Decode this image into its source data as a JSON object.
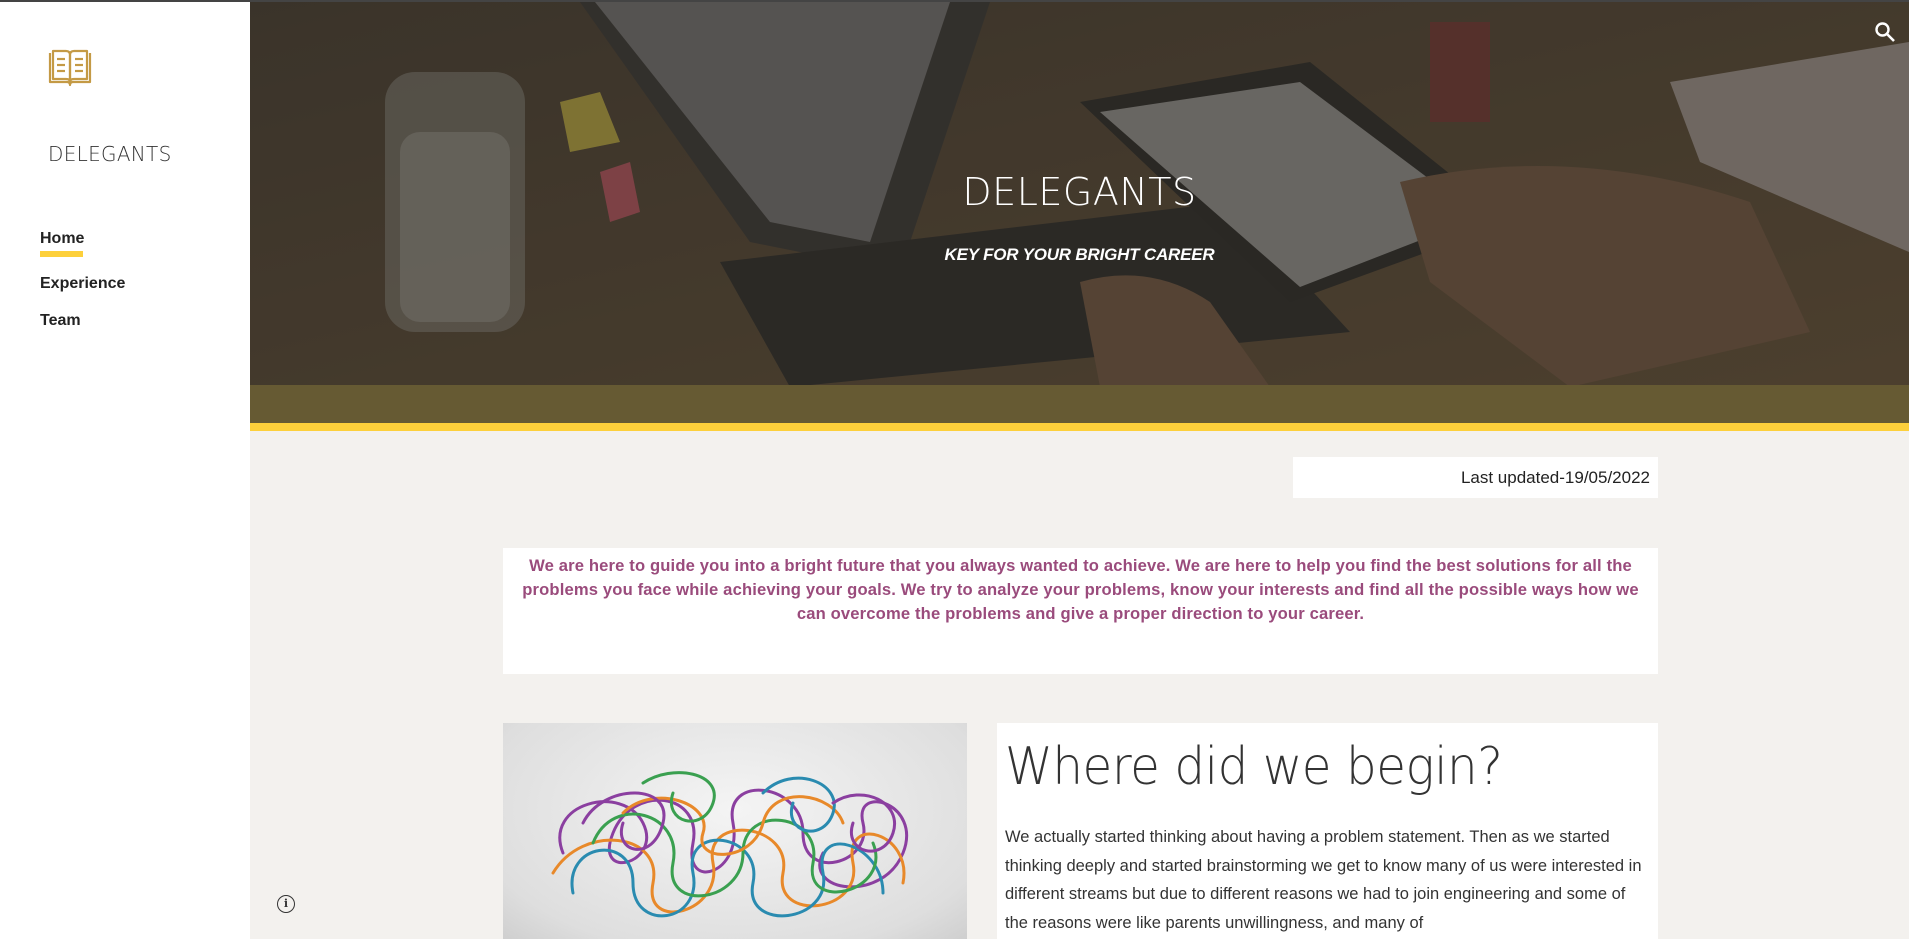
{
  "sidebar": {
    "site_name": "DELEGANTS",
    "nav": [
      {
        "label": "Home",
        "active": true
      },
      {
        "label": "Experience",
        "active": false
      },
      {
        "label": "Team",
        "active": false
      }
    ]
  },
  "hero": {
    "title": "DELEGANTS",
    "subtitle": "KEY FOR YOUR BRIGHT CAREER"
  },
  "last_updated": "Last updated-19/05/2022",
  "mission": "We are here to guide you into a bright future that you always wanted to achieve. We are here to help you find the best solutions for all the problems you face while achieving your goals. We try to analyze your problems, know your interests and find all the possible ways how we can overcome the problems and give a proper direction to your career.",
  "section": {
    "heading": "Where did we begin?",
    "body": "We actually started thinking about having a problem statement. Then as we started thinking deeply and started brainstorming we get to know many of us were interested in different streams but due to different reasons we had to join engineering and some of the reasons were like parents unwillingness, and many of"
  },
  "colors": {
    "accent": "#fdd03b",
    "band": "#665a33",
    "mission_text": "#9a4b7c",
    "logo": "#c49a45"
  }
}
